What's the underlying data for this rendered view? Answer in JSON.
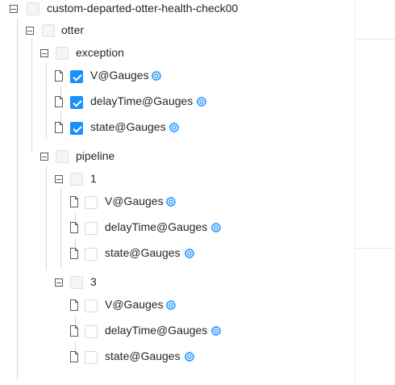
{
  "tree": {
    "root": {
      "label": "custom-departed-otter-health-check00"
    },
    "otter": {
      "label": "otter"
    },
    "exception": {
      "label": "exception",
      "items": [
        {
          "label": "V@Gauges",
          "checked": true
        },
        {
          "label": "delayTime@Gauges",
          "checked": true
        },
        {
          "label": "state@Gauges",
          "checked": true
        }
      ]
    },
    "pipeline": {
      "label": "pipeline",
      "group1": {
        "label": "1",
        "items": [
          {
            "label": "V@Gauges",
            "checked": false
          },
          {
            "label": "delayTime@Gauges",
            "checked": false
          },
          {
            "label": "state@Gauges",
            "checked": false
          }
        ]
      },
      "group3": {
        "label": "3",
        "items": [
          {
            "label": "V@Gauges",
            "checked": false
          },
          {
            "label": "delayTime@Gauges",
            "checked": false
          },
          {
            "label": "state@Gauges",
            "checked": false
          }
        ]
      }
    }
  },
  "icons": {
    "switch": "minus-square-icon",
    "file": "file-icon",
    "gear": "setting-icon"
  },
  "colors": {
    "accent": "#1890ff",
    "text": "#262626",
    "line": "#d9d9d9"
  }
}
